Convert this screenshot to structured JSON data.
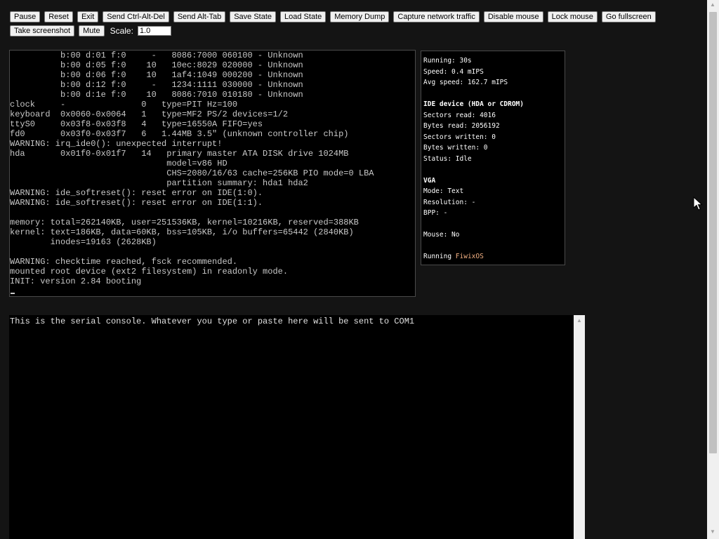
{
  "toolbar": {
    "buttons": [
      "Pause",
      "Reset",
      "Exit",
      "Send Ctrl-Alt-Del",
      "Send Alt-Tab",
      "Save State",
      "Load State",
      "Memory Dump",
      "Capture network traffic",
      "Disable mouse",
      "Lock mouse",
      "Go fullscreen",
      "Take screenshot",
      "Mute"
    ],
    "scale_label": "Scale:",
    "scale_value": "1.0"
  },
  "screen": {
    "lines": [
      "          b:00 d:01 f:0     -   8086:7000 060100 - Unknown",
      "          b:00 d:05 f:0    10   10ec:8029 020000 - Unknown",
      "          b:00 d:06 f:0    10   1af4:1049 000200 - Unknown",
      "          b:00 d:12 f:0     -   1234:1111 030000 - Unknown",
      "          b:00 d:1e f:0    10   8086:7010 010180 - Unknown",
      "clock     -               0   type=PIT Hz=100",
      "keyboard  0x0060-0x0064   1   type=MF2 PS/2 devices=1/2",
      "ttyS0     0x03f8-0x03f8   4   type=16550A FIFO=yes",
      "fd0       0x03f0-0x03f7   6   1.44MB 3.5\" (unknown controller chip)",
      "WARNING: irq_ide0(): unexpected interrupt!",
      "hda       0x01f0-0x01f7   14   primary master ATA DISK drive 1024MB",
      "                               model=v86 HD",
      "                               CHS=2080/16/63 cache=256KB PIO mode=0 LBA",
      "                               partition summary: hda1 hda2",
      "WARNING: ide_softreset(): reset error on IDE(1:0).",
      "WARNING: ide_softreset(): reset error on IDE(1:1).",
      "",
      "memory: total=262140KB, user=251536KB, kernel=10216KB, reserved=388KB",
      "kernel: text=186KB, data=60KB, bss=105KB, i/o buffers=65442 (2840KB)",
      "        inodes=19163 (2628KB)",
      "",
      "WARNING: checktime reached, fsck recommended.",
      "mounted root device (ext2 filesystem) in readonly mode.",
      "INIT: version 2.84 booting"
    ]
  },
  "stats": {
    "running": "Running: 30s",
    "speed": "Speed: 0.4 mIPS",
    "avg_speed": "Avg speed: 162.7 mIPS",
    "ide_heading": "IDE device (HDA or CDROM)",
    "sectors_read": "Sectors read: 4016",
    "bytes_read": "Bytes read: 2056192",
    "sectors_written": "Sectors written: 0",
    "bytes_written": "Bytes written: 0",
    "ide_status": "Status: Idle",
    "vga_heading": "VGA",
    "vga_mode": "Mode: Text",
    "vga_resolution": "Resolution: -",
    "vga_bpp": "BPP: -",
    "mouse": "Mouse: No",
    "running_os_label": "Running",
    "running_os_name": "FiwixOS",
    "os_link_color": "#f4b183"
  },
  "serial": {
    "text": "This is the serial console. Whatever you type or paste here will be sent to COM1"
  },
  "icons": [
    "scroll-up-icon",
    "scroll-down-icon",
    "mouse-pointer-icon"
  ]
}
